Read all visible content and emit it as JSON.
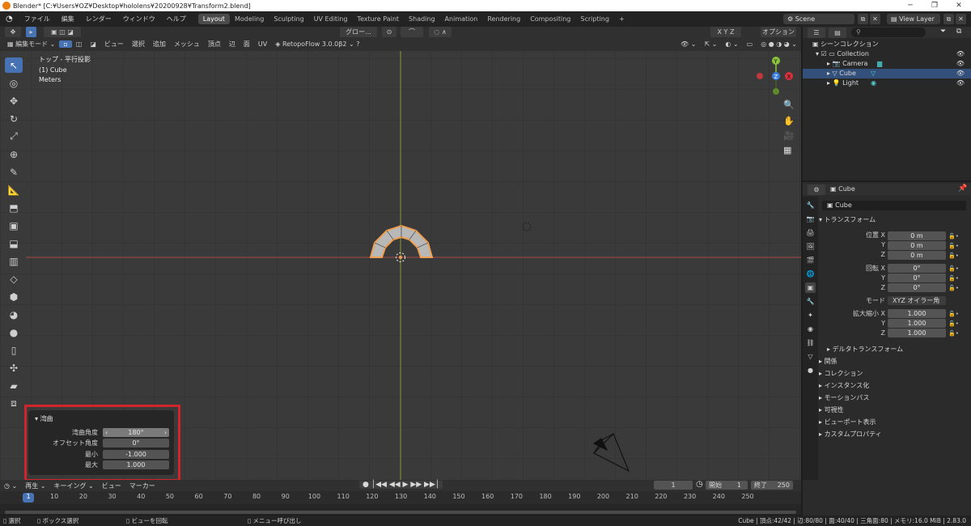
{
  "window": {
    "title": "Blender* [C:¥Users¥OZ¥Desktop¥hololens¥20200928¥Transform2.blend]"
  },
  "menu": [
    "ファイル",
    "編集",
    "レンダー",
    "ウィンドウ",
    "ヘルプ"
  ],
  "workspaces": [
    "Layout",
    "Modeling",
    "Sculpting",
    "UV Editing",
    "Texture Paint",
    "Shading",
    "Animation",
    "Rendering",
    "Compositing",
    "Scripting",
    "+"
  ],
  "scene": {
    "label": "Scene",
    "view_layer": "View Layer"
  },
  "viewport_header": {
    "mode": "編集モード",
    "menus": [
      "ビュー",
      "選択",
      "追加",
      "メッシュ",
      "頂点",
      "辺",
      "面",
      "UV"
    ],
    "addon": "RetopoFlow 3.0.0β2",
    "orientation": "グロー...",
    "options": "オプション"
  },
  "viewport_info": {
    "line1": "トップ - 平行投影",
    "line2": "(1) Cube",
    "line3": "Meters"
  },
  "gizmo": {
    "x": "X",
    "y": "Y",
    "z": "Z"
  },
  "operator_panel": {
    "title": "湾曲",
    "rows": [
      {
        "label": "湾曲角度",
        "value": "180°"
      },
      {
        "label": "オフセット角度",
        "value": "0°"
      },
      {
        "label": "最小",
        "value": "-1.000"
      },
      {
        "label": "最大",
        "value": "1.000"
      }
    ]
  },
  "outliner": {
    "title": "シーンコレクション",
    "items": [
      "Collection",
      "Camera",
      "Cube",
      "Light"
    ]
  },
  "properties": {
    "object_name": "Cube",
    "data_name": "Cube",
    "transform_title": "トランスフォーム",
    "location_label": "位置 X",
    "rotation_label": "回転 X",
    "scale_label": "拡大縮小 X",
    "axis_y": "Y",
    "axis_z": "Z",
    "location": [
      "0 m",
      "0 m",
      "0 m"
    ],
    "rotation": [
      "0°",
      "0°",
      "0°"
    ],
    "mode_label": "モード",
    "mode_value": "XYZ オイラー角",
    "scale": [
      "1.000",
      "1.000",
      "1.000"
    ],
    "sections": [
      "デルタトランスフォーム",
      "関係",
      "コレクション",
      "インスタンス化",
      "モーションパス",
      "可視性",
      "ビューポート表示",
      "カスタムプロパティ"
    ]
  },
  "timeline": {
    "menus": [
      "再生",
      "キーイング",
      "ビュー",
      "マーカー"
    ],
    "current_frame": "1",
    "start_label": "開始",
    "start": "1",
    "end_label": "終了",
    "end": "250",
    "ticks": [
      "1",
      "10",
      "20",
      "30",
      "40",
      "50",
      "60",
      "70",
      "80",
      "90",
      "100",
      "110",
      "120",
      "130",
      "140",
      "150",
      "160",
      "170",
      "180",
      "190",
      "200",
      "210",
      "220",
      "230",
      "240",
      "250"
    ]
  },
  "statusbar": {
    "left": [
      "選択",
      "ボックス選択",
      "ビューを回転",
      "メニュー呼び出し"
    ],
    "right": "Cube | 頂点:42/42 | 辺:80/80 | 面:40/40 | 三角面:80 | メモリ:16.0 MiB | 2.83.0"
  }
}
